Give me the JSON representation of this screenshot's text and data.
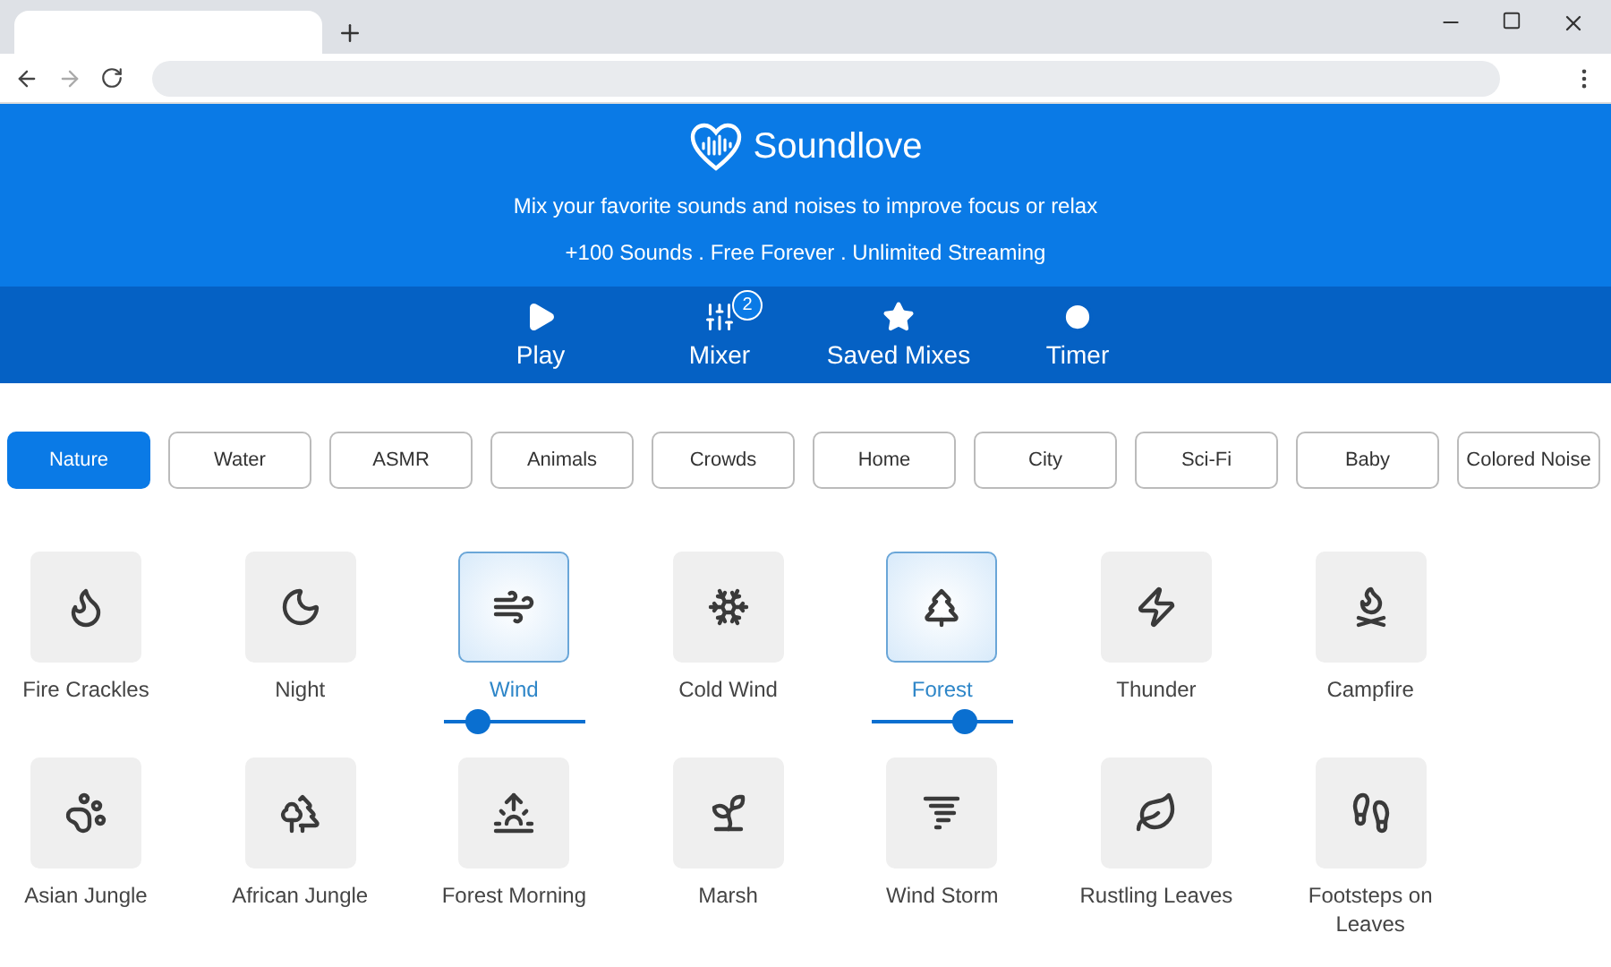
{
  "app": {
    "title": "Soundlove",
    "subtitle": "Mix your favorite sounds and noises to improve focus or relax",
    "tagline": "+100 Sounds . Free Forever . Unlimited Streaming"
  },
  "nav": [
    {
      "label": "Play"
    },
    {
      "label": "Mixer",
      "badge": "2"
    },
    {
      "label": "Saved Mixes"
    },
    {
      "label": "Timer"
    }
  ],
  "categories": [
    {
      "label": "Nature",
      "selected": true
    },
    {
      "label": "Water",
      "selected": false
    },
    {
      "label": "ASMR",
      "selected": false
    },
    {
      "label": "Animals",
      "selected": false
    },
    {
      "label": "Crowds",
      "selected": false
    },
    {
      "label": "Home",
      "selected": false
    },
    {
      "label": "City",
      "selected": false
    },
    {
      "label": "Sci-Fi",
      "selected": false
    },
    {
      "label": "Baby",
      "selected": false
    },
    {
      "label": "Colored Noise",
      "selected": false
    }
  ],
  "sounds": [
    {
      "label": "Fire Crackles",
      "selected": false
    },
    {
      "label": "Night",
      "selected": false
    },
    {
      "label": "Wind",
      "selected": true,
      "level": 0.25
    },
    {
      "label": "Cold Wind",
      "selected": false
    },
    {
      "label": "Forest",
      "selected": true,
      "level": 0.66
    },
    {
      "label": "Thunder",
      "selected": false
    },
    {
      "label": "Campfire",
      "selected": false
    },
    {
      "label": "Asian Jungle",
      "selected": false
    },
    {
      "label": "African Jungle",
      "selected": false
    },
    {
      "label": "Forest Morning",
      "selected": false
    },
    {
      "label": "Marsh",
      "selected": false
    },
    {
      "label": "Wind Storm",
      "selected": false
    },
    {
      "label": "Rustling Leaves",
      "selected": false
    },
    {
      "label": "Footsteps on Leaves",
      "selected": false
    }
  ]
}
